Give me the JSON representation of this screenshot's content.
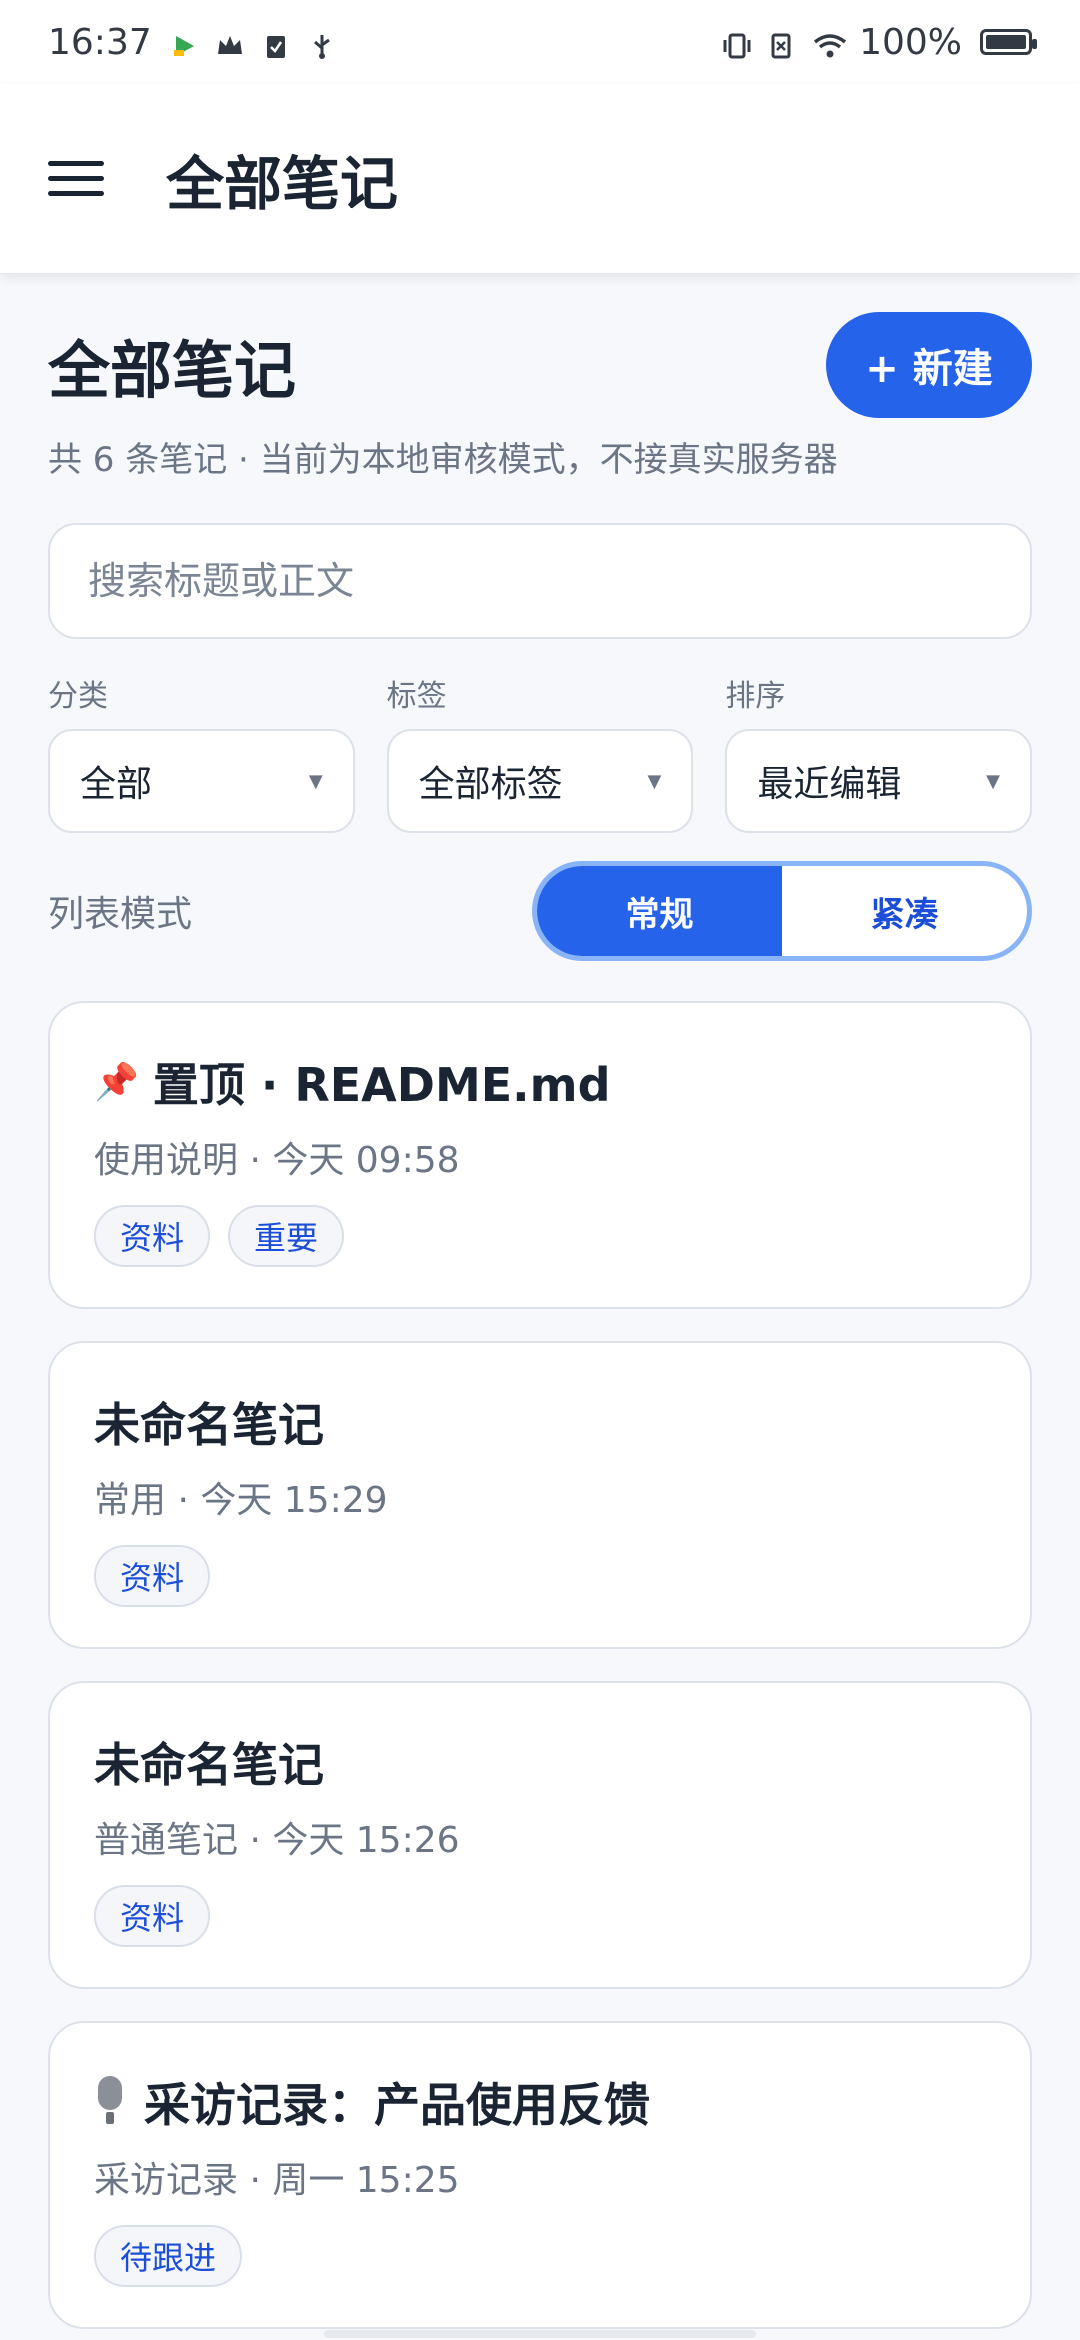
{
  "status": {
    "time": "16:37",
    "battery": "100%"
  },
  "app_bar": {
    "title": "全部笔记"
  },
  "header": {
    "title": "全部笔记",
    "new_label": "+ 新建",
    "subtitle": "共 6 条笔记 · 当前为本地审核模式，不接真实服务器"
  },
  "search": {
    "placeholder": "搜索标题或正文"
  },
  "filters": {
    "category_label": "分类",
    "category_value": "全部",
    "tag_label": "标签",
    "tag_value": "全部标签",
    "sort_label": "排序",
    "sort_value": "最近编辑"
  },
  "list_mode": {
    "label": "列表模式",
    "normal": "常规",
    "compact": "紧凑"
  },
  "notes": [
    {
      "pin": "📌",
      "title": "置顶 · README.md",
      "meta": "使用说明 · 今天 09:58",
      "tags": [
        "资料",
        "重要"
      ]
    },
    {
      "title": "未命名笔记",
      "meta": "常用 · 今天 15:29",
      "tags": [
        "资料"
      ]
    },
    {
      "title": "未命名笔记",
      "meta": "普通笔记 · 今天 15:26",
      "tags": [
        "资料"
      ]
    },
    {
      "title": "采访记录：产品使用反馈",
      "meta": "采访记录 · 周一 15:25",
      "tags": [
        "待跟进"
      ]
    }
  ]
}
